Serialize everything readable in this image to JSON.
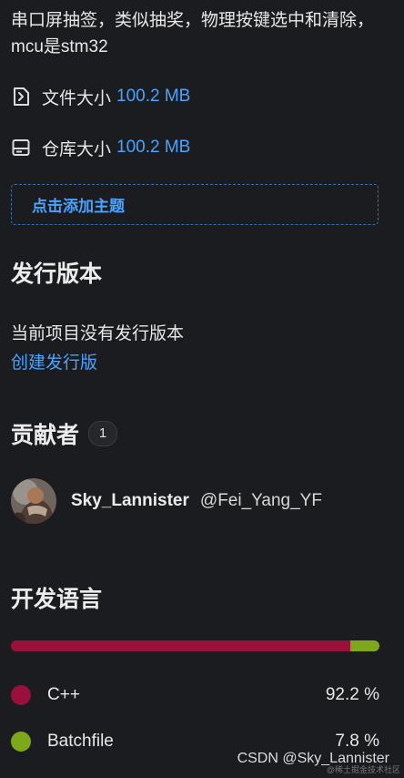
{
  "description": "串口屏抽签，类似抽奖，物理按键选中和清除，mcu是stm32",
  "meta": {
    "file_size_label": "文件大小",
    "file_size_value": "100.2 MB",
    "repo_size_label": "仓库大小",
    "repo_size_value": "100.2 MB"
  },
  "topic": {
    "add_label": "点击添加主题"
  },
  "releases": {
    "heading": "发行版本",
    "empty_text": "当前项目没有发行版本",
    "create_link": "创建发行版"
  },
  "contributors": {
    "heading": "贡献者",
    "count": "1",
    "items": [
      {
        "name": "Sky_Lannister",
        "handle": "@Fei_Yang_YF"
      }
    ]
  },
  "languages": {
    "heading": "开发语言",
    "items": [
      {
        "name": "C++",
        "percent": "92.2 %",
        "value": 92.2,
        "color": "#99113a"
      },
      {
        "name": "Batchfile",
        "percent": "7.8 %",
        "value": 7.8,
        "color": "#7ea71a"
      }
    ]
  },
  "watermark": {
    "main": "CSDN @Sky_Lannister",
    "small": "@稀土掘金技术社区"
  },
  "icons": {
    "file_size": "file-zip-icon",
    "repo_size": "database-icon"
  },
  "colors": {
    "background": "#1b1c1f",
    "link": "#4aa3ff",
    "text": "#e8e8e8"
  }
}
